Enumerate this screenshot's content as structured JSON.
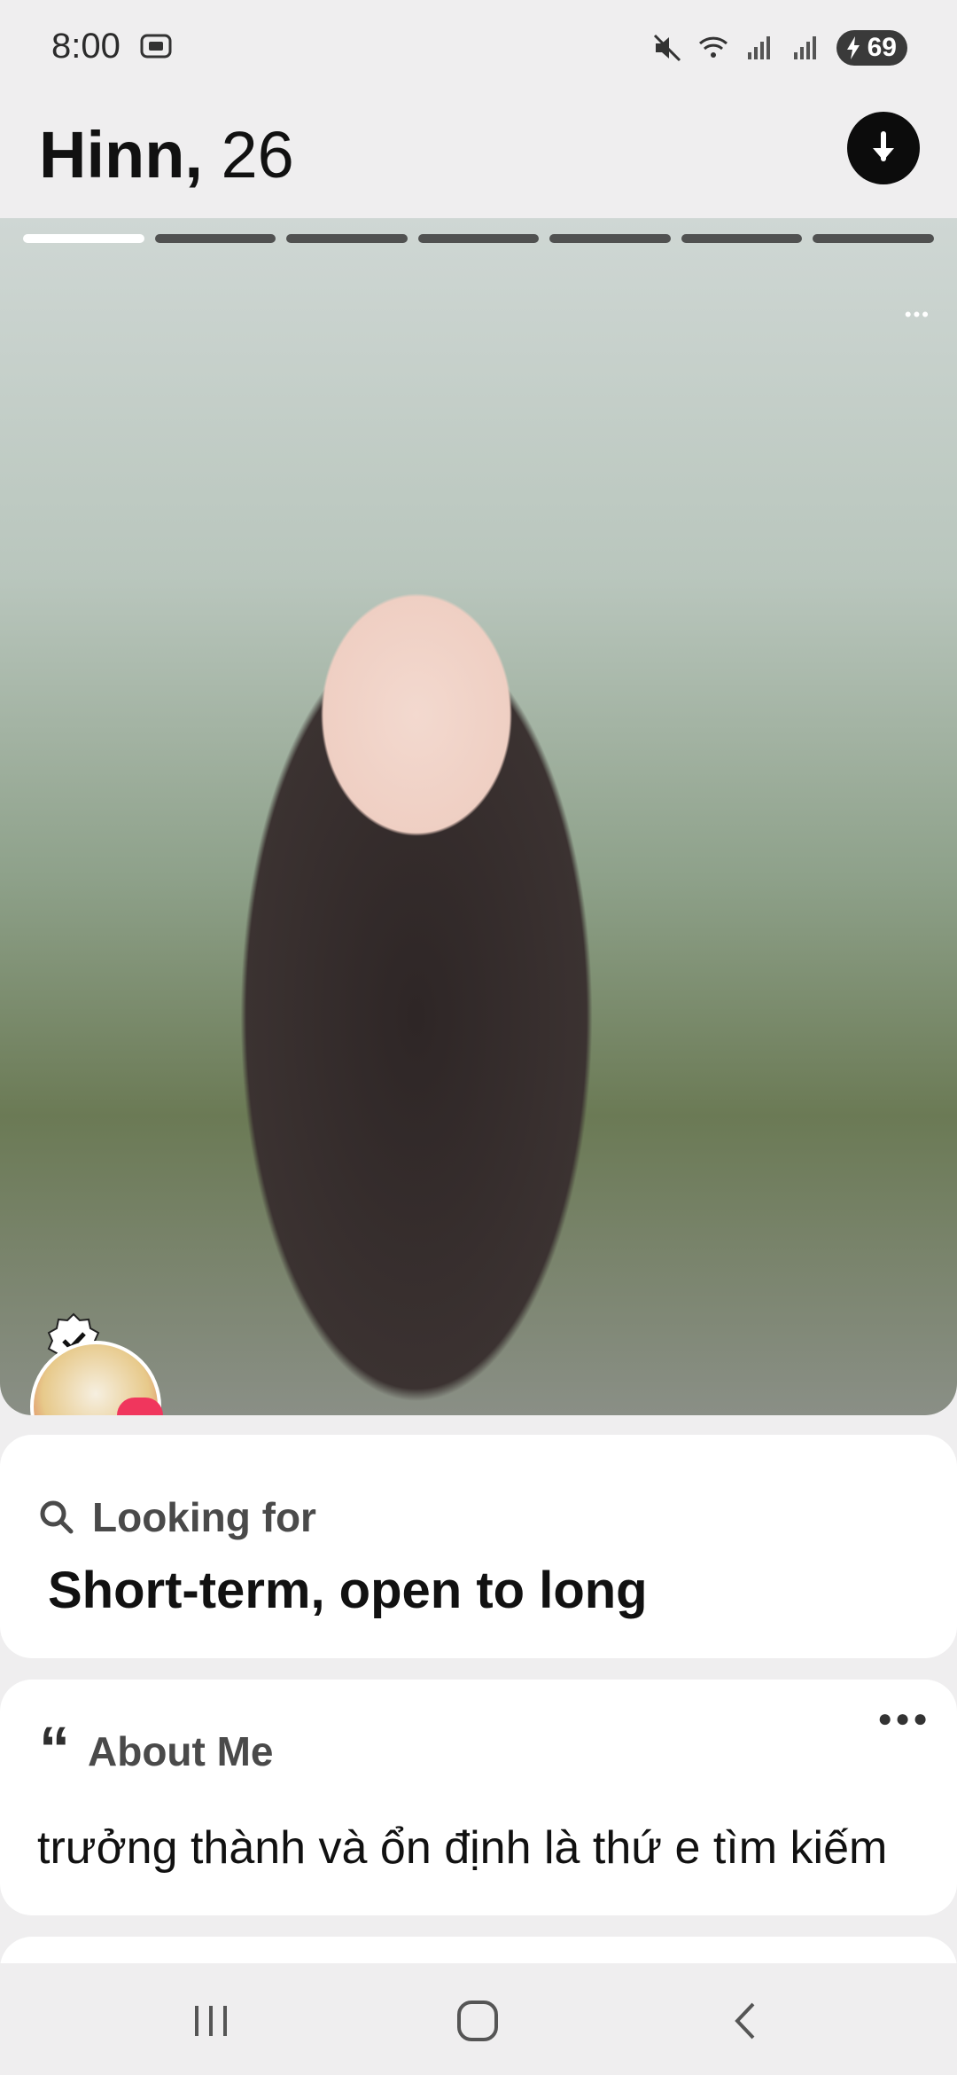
{
  "status_bar": {
    "time": "8:00",
    "battery": "69",
    "icons": [
      "screenshot-icon",
      "mute-icon",
      "wifi-icon",
      "signal-icon",
      "signal-icon",
      "battery-icon"
    ]
  },
  "profile": {
    "name": "Hinn,",
    "age": "26",
    "photo_count": 7,
    "active_photo": 1
  },
  "looking_for": {
    "title": "Looking for",
    "value": "Short-term, open to long"
  },
  "about_me": {
    "title": "About Me",
    "text": "trưởng thành và ổn định là thứ e tìm kiếm"
  },
  "nav": {
    "icons": [
      "recents-icon",
      "home-icon",
      "back-icon"
    ]
  }
}
